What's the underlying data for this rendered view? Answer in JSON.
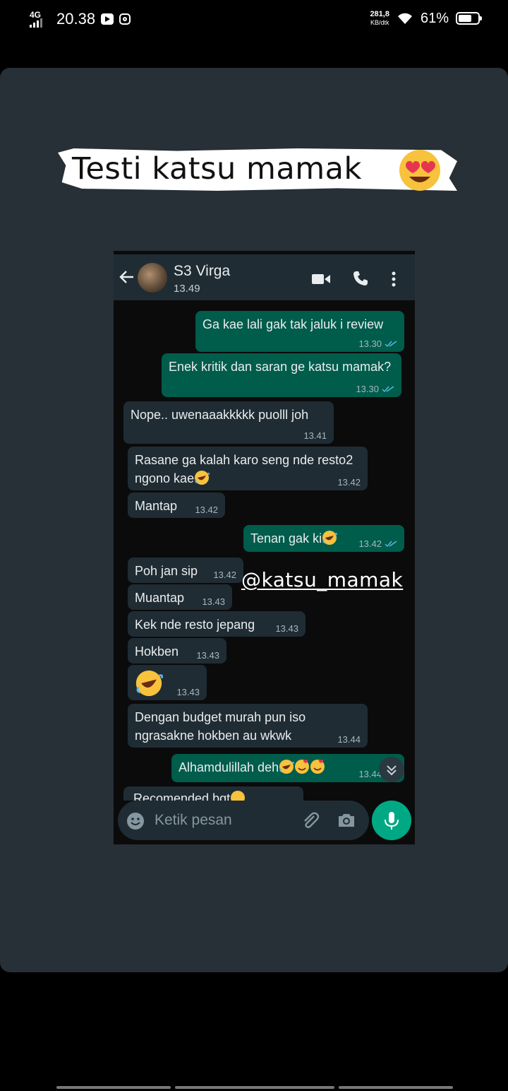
{
  "status_bar": {
    "network": "4G",
    "time": "20.38",
    "speed_value": "281,8",
    "speed_unit": "KB/dtk",
    "battery": "61%",
    "battery_level": 0.61
  },
  "story": {
    "caption": "Testi  katsu mamak",
    "caption_emoji": "heart-eyes-icon",
    "watermark": "@katsu_mamak"
  },
  "chat_header": {
    "contact_name": "S3 Virga",
    "last_seen": "13.49"
  },
  "messages": [
    {
      "dir": "out",
      "text": "Ga kae lali gak tak jaluk i review",
      "time": "13.30",
      "ticks": true
    },
    {
      "dir": "out",
      "text": "Enek kritik dan saran ge katsu mamak?",
      "time": "13.30",
      "ticks": true
    },
    {
      "dir": "in",
      "text": "Nope.. uwenaaakkkkk puolll joh",
      "time": "13.41"
    },
    {
      "dir": "in",
      "text": "Rasane ga kalah karo seng nde resto2 ngono kae",
      "time": "13.42",
      "emoji": "rolling-laughing"
    },
    {
      "dir": "in",
      "text": "Mantap",
      "time": "13.42"
    },
    {
      "dir": "out",
      "text": "Tenan gak ki",
      "time": "13.42",
      "ticks": true,
      "emoji": "rolling-laughing"
    },
    {
      "dir": "in",
      "text": "Poh jan sip",
      "time": "13.42"
    },
    {
      "dir": "in",
      "text": "Muantap",
      "time": "13.43"
    },
    {
      "dir": "in",
      "text": "Kek nde resto jepang",
      "time": "13.43"
    },
    {
      "dir": "in",
      "text": "Hokben",
      "time": "13.43"
    },
    {
      "dir": "in",
      "text": "",
      "time": "13.43",
      "emoji": "rolling-laughing"
    },
    {
      "dir": "in",
      "text": "Dengan budget murah pun iso ngrasakne hokben au wkwk",
      "time": "13.44"
    },
    {
      "dir": "out",
      "text": "Alhamdulillah deh",
      "time": "13.44",
      "ticks": true,
      "emoji": "rolling-laughing, smiling-hearts, smiling-hearts"
    },
    {
      "dir": "in",
      "text": "Recomended bgt",
      "time": "",
      "emoji": "laughing-tears",
      "partial": true
    }
  ],
  "input": {
    "placeholder": "Ketik pesan"
  },
  "colors": {
    "story_bg": "#272f37",
    "header_bg": "#1f2c33",
    "incoming_bubble": "#1f2c33",
    "outgoing_bubble": "#005c4b",
    "accent": "#00a884",
    "tick_blue": "#53bdeb"
  }
}
